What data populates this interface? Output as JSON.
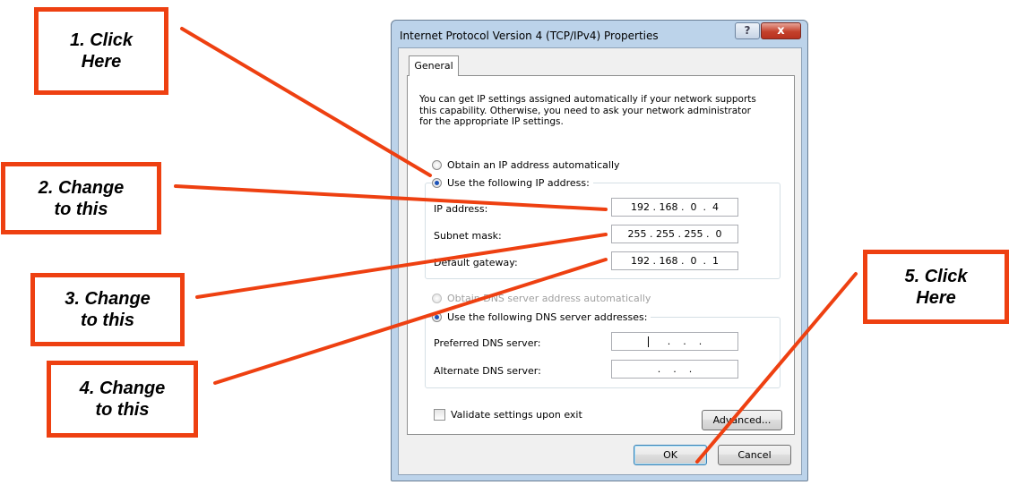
{
  "dialog": {
    "title": "Internet Protocol Version 4 (TCP/IPv4) Properties",
    "help_label": "?",
    "close_label": "x",
    "tab_general": "General",
    "intro_lines": [
      "You can get IP settings assigned automatically if your network supports",
      "this capability. Otherwise, you need to ask your network administrator",
      "for the appropriate IP settings."
    ],
    "obtain_ip_auto": "Obtain an IP address automatically",
    "use_following_ip": "Use the following IP address:",
    "ip_address_label": "IP address:",
    "ip_address_value": "192 . 168 .  0  .  4",
    "subnet_mask_label": "Subnet mask:",
    "subnet_mask_value": "255 . 255 . 255 .  0",
    "default_gateway_label": "Default gateway:",
    "default_gateway_value": "192 . 168 .  0  .  1",
    "obtain_dns_auto": "Obtain DNS server address automatically",
    "use_following_dns": "Use the following DNS server addresses:",
    "preferred_dns_label": "Preferred DNS server:",
    "preferred_dns_value": "  .    .    .",
    "alternate_dns_label": "Alternate DNS server:",
    "alternate_dns_value": ".    .    .",
    "validate_label": "Validate settings upon exit",
    "advanced_label": "Advanced...",
    "ok_label": "OK",
    "cancel_label": "Cancel",
    "selected_ip_mode": "manual",
    "selected_dns_mode": "manual",
    "validate_checked": false
  },
  "annotations": {
    "callout1": [
      "1. Click",
      "Here"
    ],
    "callout2": [
      "2. Change",
      "to this"
    ],
    "callout3": [
      "3. Change",
      "to this"
    ],
    "callout4": [
      "4. Change",
      "to this"
    ],
    "callout5": [
      "5. Click",
      "Here"
    ],
    "accent_color": "#ee4011"
  }
}
